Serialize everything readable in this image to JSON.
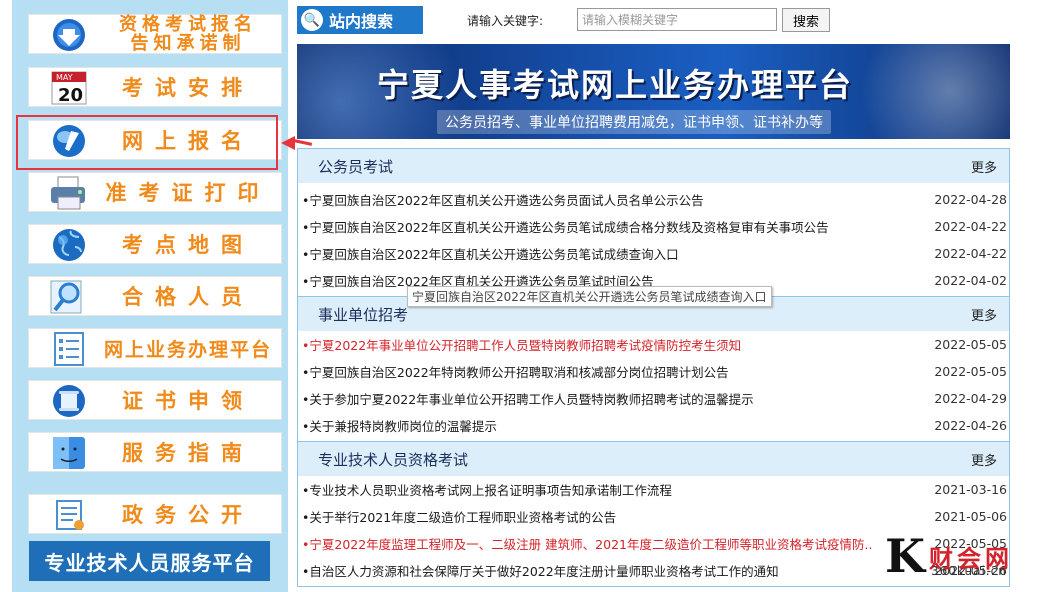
{
  "sidebar": {
    "items": [
      {
        "label_line1": "资格考试报名",
        "label_line2": "告知承诺制",
        "icon": "download-arrow-icon"
      },
      {
        "label": "考试安排",
        "icon": "calendar-icon",
        "calendar_month": "MAY",
        "calendar_day": "20"
      },
      {
        "label": "网上报名",
        "icon": "globe-pen-icon"
      },
      {
        "label": "准考证打印",
        "icon": "printer-icon"
      },
      {
        "label": "考点地图",
        "icon": "earth-icon"
      },
      {
        "label": "合格人员",
        "icon": "magnifier-icon"
      },
      {
        "label": "网上业务办理平台",
        "icon": "checklist-icon"
      },
      {
        "label": "证书申领",
        "icon": "scroll-icon"
      },
      {
        "label": "服务指南",
        "icon": "mac-finder-icon"
      },
      {
        "label": "政务公开",
        "icon": "document-icon"
      }
    ],
    "service_platform": "专业技术人员服务平台"
  },
  "search": {
    "tab_label": "站内搜索",
    "prompt": "请输入关键字:",
    "placeholder": "请输入模糊关键字",
    "button": "搜索"
  },
  "banner": {
    "title": "宁夏人事考试网上业务办理平台",
    "subtitle": "公务员招考、事业单位招聘费用减免，证书申领、证书补办等"
  },
  "sections": [
    {
      "title": "公务员考试",
      "more": "更多",
      "items": [
        {
          "text": "•宁夏回族自治区2022年区直机关公开遴选公务员面试人员名单公示公告",
          "date": "2022-04-28",
          "red": false
        },
        {
          "text": "•宁夏回族自治区2022年区直机关公开遴选公务员笔试成绩合格分数线及资格复审有关事项公告",
          "date": "2022-04-22",
          "red": false
        },
        {
          "text": "•宁夏回族自治区2022年区直机关公开遴选公务员笔试成绩查询入口",
          "date": "2022-04-22",
          "red": false
        },
        {
          "text": "•宁夏回族自治区2022年区直机关公开遴选公务员笔试时间公告",
          "date": "2022-04-02",
          "red": false
        }
      ]
    },
    {
      "title": "事业单位招考",
      "more": "更多",
      "items": [
        {
          "text": "•宁夏2022年事业单位公开招聘工作人员暨特岗教师招聘考试疫情防控考生须知",
          "date": "2022-05-05",
          "red": true
        },
        {
          "text": "•宁夏回族自治区2022年特岗教师公开招聘取消和核减部分岗位招聘计划公告",
          "date": "2022-05-05",
          "red": false
        },
        {
          "text": "•关于参加宁夏2022年事业单位公开招聘工作人员暨特岗教师招聘考试的温馨提示",
          "date": "2022-04-29",
          "red": false
        },
        {
          "text": "•关于兼报特岗教师岗位的温馨提示",
          "date": "2022-04-26",
          "red": false
        }
      ]
    },
    {
      "title": "专业技术人员资格考试",
      "more": "更多",
      "items": [
        {
          "text": "•专业技术人员职业资格考试网上报名证明事项告知承诺制工作流程",
          "date": "2021-03-16",
          "red": false
        },
        {
          "text": "•关于举行2021年度二级造价工程师职业资格考试的公告",
          "date": "2021-05-06",
          "red": false
        },
        {
          "text": "•宁夏2022年度监理工程师及一、二级注册 建筑师、2021年度二级造价工程师等职业资格考试疫情防..",
          "date": "2022-05-05",
          "red": true
        },
        {
          "text": "•自治区人力资源和社会保障厅关于做好2022年度注册计量师职业资格考试工作的通知",
          "date": "2022-05-26",
          "red": false
        }
      ]
    }
  ],
  "tooltip": "宁夏回族自治区2022年区直机关公开遴选公务员笔试成绩查询入口",
  "watermark": {
    "letter": "K",
    "text": "财会网",
    "url": "360kuai.cn"
  }
}
